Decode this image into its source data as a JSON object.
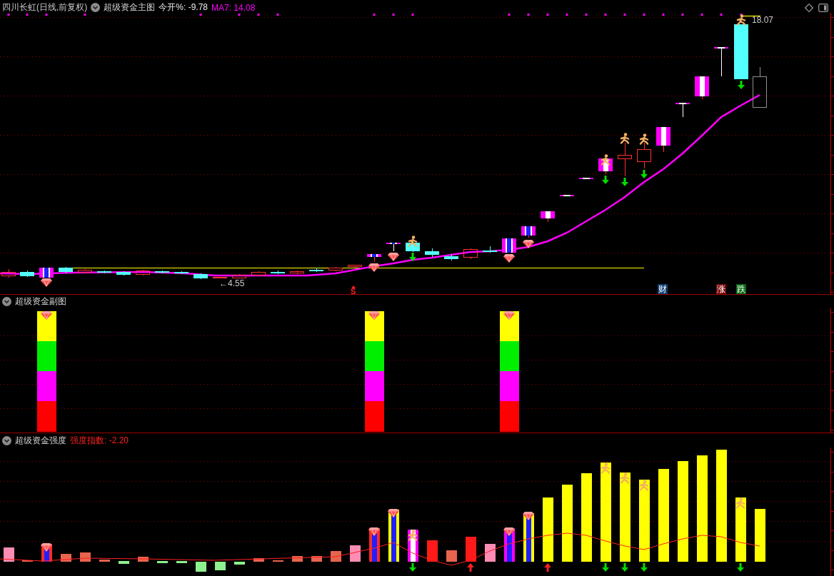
{
  "header": {
    "title": "四川长虹(日线,前复权)",
    "indicator": "超级资金主图",
    "open_change": "今开%: -9.78",
    "ma7": "MA7: 14.08"
  },
  "main_chart": {
    "low_label": "←4.55",
    "high_label": "18.07",
    "signal": "S",
    "tags": [
      {
        "text": "财",
        "color": "#0e3d6e"
      },
      {
        "text": "涨",
        "color": "#7a0a0a"
      },
      {
        "text": "跌",
        "color": "#0a6a14"
      }
    ]
  },
  "sub_chart": {
    "title": "超级资金副图"
  },
  "strength_chart": {
    "title": "超级资金强度",
    "index": "强度指数: -2.20"
  }
}
